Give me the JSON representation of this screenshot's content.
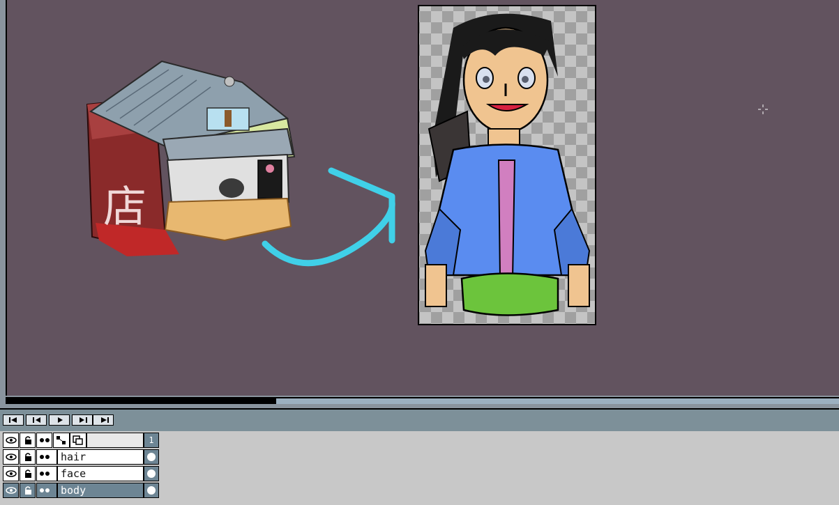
{
  "timeline": {
    "frame_number": "1",
    "controls": [
      "first-frame",
      "previous-frame",
      "play",
      "next-frame",
      "last-frame"
    ]
  },
  "layers": [
    {
      "name": "hair"
    },
    {
      "name": "face"
    },
    {
      "name": "body",
      "selected": true
    }
  ],
  "canvas": {
    "sign_character": "店",
    "colors": {
      "canvas_bg": "#62535f",
      "arrow": "#40d0e8",
      "shirt": "#5a8cf0",
      "skirt": "#6cc43c",
      "skin": "#f0c490",
      "tie": "#d17fc0"
    }
  }
}
